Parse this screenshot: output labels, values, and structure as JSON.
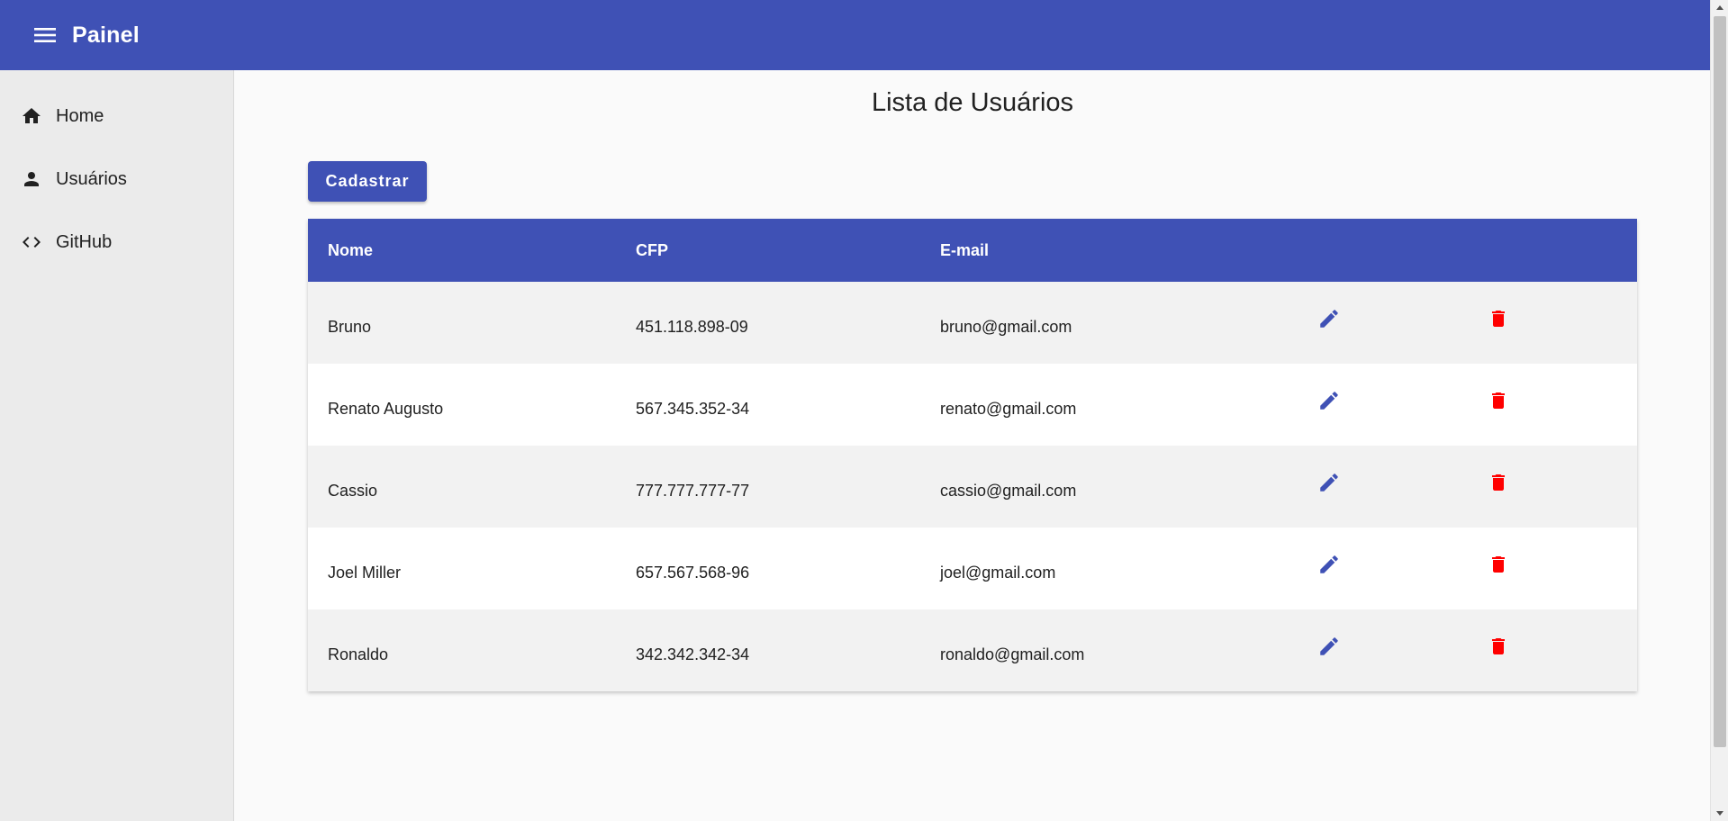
{
  "appbar": {
    "title": "Painel",
    "menu_icon": "menu-icon",
    "color": "#3f51b5"
  },
  "sidebar": {
    "items": [
      {
        "label": "Home",
        "icon": "home-icon"
      },
      {
        "label": "Usuários",
        "icon": "person-icon"
      },
      {
        "label": "GitHub",
        "icon": "code-icon"
      }
    ]
  },
  "main": {
    "title": "Lista de Usuários",
    "register_button": "Cadastrar"
  },
  "table": {
    "headers": [
      "Nome",
      "CFP",
      "E-mail"
    ],
    "rows": [
      {
        "nome": "Bruno",
        "cfp": "451.118.898-09",
        "email": "bruno@gmail.com"
      },
      {
        "nome": "Renato Augusto",
        "cfp": "567.345.352-34",
        "email": "renato@gmail.com"
      },
      {
        "nome": "Cassio",
        "cfp": "777.777.777-77",
        "email": "cassio@gmail.com"
      },
      {
        "nome": "Joel Miller",
        "cfp": "657.567.568-96",
        "email": "joel@gmail.com"
      },
      {
        "nome": "Ronaldo",
        "cfp": "342.342.342-34",
        "email": "ronaldo@gmail.com"
      }
    ],
    "edit_icon": "pencil-icon",
    "delete_icon": "trash-icon",
    "edit_color": "#3f51b5",
    "delete_color": "#ff0000"
  }
}
